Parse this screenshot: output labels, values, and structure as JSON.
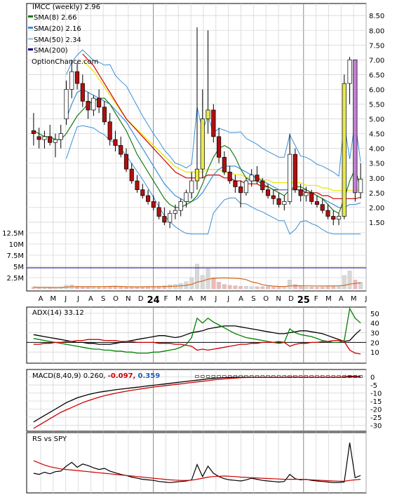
{
  "chart_data": [
    {
      "type": "candlestick",
      "panel": "price",
      "title": "IMCC (weekly) 2.96",
      "watermark": "OptionChance.com",
      "legend": [
        {
          "label": "SMA(8) 2.66",
          "color": "#1a7a1a"
        },
        {
          "label": "SMA(20) 2.16",
          "color": "#3a8fd6"
        },
        {
          "label": "SMA(50) 2.34",
          "color": "#a8d0f0"
        },
        {
          "label": "SMA(200)",
          "color": "#00008b"
        }
      ],
      "y_ticks": [
        "8.50",
        "8.00",
        "7.50",
        "7.00",
        "6.50",
        "6.00",
        "5.50",
        "5.00",
        "4.50",
        "4.00",
        "3.50",
        "3.00",
        "2.50",
        "2.00",
        "1.50"
      ],
      "ylim": [
        1.0,
        8.6
      ],
      "volume_ticks": [
        "12.5M",
        "10M",
        "7.5M",
        "5M",
        "2.5M"
      ],
      "x_labels": [
        "A",
        "M",
        "J",
        "J",
        "A",
        "S",
        "O",
        "N",
        "D",
        "24",
        "F",
        "M",
        "A",
        "M",
        "J",
        "J",
        "A",
        "S",
        "O",
        "N",
        "D",
        "25",
        "F",
        "M",
        "A",
        "M",
        "J"
      ],
      "year_labels": [
        "24",
        "25"
      ],
      "candles": [
        {
          "o": 4.6,
          "h": 5.2,
          "l": 4.1,
          "c": 4.5
        },
        {
          "o": 4.4,
          "h": 4.7,
          "l": 4.0,
          "c": 4.3
        },
        {
          "o": 4.3,
          "h": 4.6,
          "l": 4.0,
          "c": 4.4
        },
        {
          "o": 4.4,
          "h": 4.8,
          "l": 4.1,
          "c": 4.2
        },
        {
          "o": 4.2,
          "h": 4.5,
          "l": 3.7,
          "c": 4.3
        },
        {
          "o": 4.3,
          "h": 4.8,
          "l": 4.0,
          "c": 4.5
        },
        {
          "o": 5.0,
          "h": 6.3,
          "l": 4.8,
          "c": 6.0
        },
        {
          "o": 6.0,
          "h": 7.0,
          "l": 5.7,
          "c": 6.6
        },
        {
          "o": 6.6,
          "h": 6.9,
          "l": 6.0,
          "c": 6.2
        },
        {
          "o": 6.2,
          "h": 6.5,
          "l": 5.4,
          "c": 5.6
        },
        {
          "o": 5.6,
          "h": 5.9,
          "l": 5.0,
          "c": 5.3
        },
        {
          "o": 5.3,
          "h": 5.8,
          "l": 5.1,
          "c": 5.7
        },
        {
          "o": 5.7,
          "h": 6.0,
          "l": 5.2,
          "c": 5.4
        },
        {
          "o": 5.4,
          "h": 5.6,
          "l": 4.8,
          "c": 4.9
        },
        {
          "o": 4.9,
          "h": 5.2,
          "l": 4.1,
          "c": 4.3
        },
        {
          "o": 4.3,
          "h": 4.6,
          "l": 3.9,
          "c": 4.1
        },
        {
          "o": 4.1,
          "h": 4.4,
          "l": 3.7,
          "c": 3.8
        },
        {
          "o": 3.8,
          "h": 4.0,
          "l": 3.2,
          "c": 3.3
        },
        {
          "o": 3.3,
          "h": 3.5,
          "l": 2.8,
          "c": 2.9
        },
        {
          "o": 2.9,
          "h": 3.1,
          "l": 2.5,
          "c": 2.6
        },
        {
          "o": 2.6,
          "h": 2.8,
          "l": 2.3,
          "c": 2.4
        },
        {
          "o": 2.4,
          "h": 2.6,
          "l": 2.1,
          "c": 2.2
        },
        {
          "o": 2.2,
          "h": 2.4,
          "l": 1.9,
          "c": 2.0
        },
        {
          "o": 2.0,
          "h": 2.2,
          "l": 1.6,
          "c": 1.7
        },
        {
          "o": 1.7,
          "h": 2.0,
          "l": 1.4,
          "c": 1.5
        },
        {
          "o": 1.5,
          "h": 1.9,
          "l": 1.3,
          "c": 1.8
        },
        {
          "o": 1.8,
          "h": 2.1,
          "l": 1.6,
          "c": 1.9
        },
        {
          "o": 1.9,
          "h": 2.3,
          "l": 1.7,
          "c": 2.2
        },
        {
          "o": 2.2,
          "h": 2.6,
          "l": 2.0,
          "c": 2.5
        },
        {
          "o": 2.5,
          "h": 3.2,
          "l": 2.3,
          "c": 2.9
        },
        {
          "o": 2.9,
          "h": 8.1,
          "l": 2.6,
          "c": 3.3
        },
        {
          "o": 3.3,
          "h": 6.0,
          "l": 3.0,
          "c": 5.0
        },
        {
          "o": 5.0,
          "h": 8.0,
          "l": 4.5,
          "c": 5.3
        },
        {
          "o": 5.3,
          "h": 5.5,
          "l": 4.2,
          "c": 4.4
        },
        {
          "o": 4.4,
          "h": 4.7,
          "l": 3.5,
          "c": 3.7
        },
        {
          "o": 3.7,
          "h": 3.9,
          "l": 3.1,
          "c": 3.2
        },
        {
          "o": 3.2,
          "h": 3.4,
          "l": 2.8,
          "c": 2.9
        },
        {
          "o": 2.9,
          "h": 3.1,
          "l": 2.5,
          "c": 2.7
        },
        {
          "o": 2.7,
          "h": 2.9,
          "l": 2.0,
          "c": 2.5
        },
        {
          "o": 2.5,
          "h": 3.0,
          "l": 2.4,
          "c": 2.9
        },
        {
          "o": 2.9,
          "h": 3.3,
          "l": 2.7,
          "c": 3.1
        },
        {
          "o": 3.1,
          "h": 3.4,
          "l": 2.8,
          "c": 2.9
        },
        {
          "o": 2.9,
          "h": 3.0,
          "l": 2.5,
          "c": 2.6
        },
        {
          "o": 2.6,
          "h": 2.8,
          "l": 2.3,
          "c": 2.4
        },
        {
          "o": 2.4,
          "h": 2.6,
          "l": 2.1,
          "c": 2.3
        },
        {
          "o": 2.3,
          "h": 2.5,
          "l": 2.0,
          "c": 2.1
        },
        {
          "o": 2.1,
          "h": 2.4,
          "l": 1.9,
          "c": 2.2
        },
        {
          "o": 2.2,
          "h": 4.5,
          "l": 2.1,
          "c": 3.8
        },
        {
          "o": 3.8,
          "h": 4.0,
          "l": 2.5,
          "c": 2.6
        },
        {
          "o": 2.6,
          "h": 2.8,
          "l": 2.2,
          "c": 2.4
        },
        {
          "o": 2.4,
          "h": 2.7,
          "l": 2.2,
          "c": 2.5
        },
        {
          "o": 2.5,
          "h": 2.6,
          "l": 2.1,
          "c": 2.2
        },
        {
          "o": 2.2,
          "h": 2.4,
          "l": 2.0,
          "c": 2.1
        },
        {
          "o": 2.1,
          "h": 2.3,
          "l": 1.8,
          "c": 1.9
        },
        {
          "o": 1.9,
          "h": 2.1,
          "l": 1.6,
          "c": 1.7
        },
        {
          "o": 1.7,
          "h": 1.9,
          "l": 1.4,
          "c": 1.6
        },
        {
          "o": 1.6,
          "h": 1.8,
          "l": 1.4,
          "c": 1.7
        },
        {
          "o": 1.7,
          "h": 6.5,
          "l": 1.6,
          "c": 6.2
        },
        {
          "o": 6.2,
          "h": 7.1,
          "l": 5.5,
          "c": 7.0
        },
        {
          "o": 7.0,
          "h": 7.0,
          "l": 2.2,
          "c": 2.5
        },
        {
          "o": 2.5,
          "h": 3.5,
          "l": 2.3,
          "c": 2.96
        }
      ],
      "sma8": [
        4.6,
        4.5,
        4.4,
        4.4,
        4.3,
        4.3,
        4.5,
        4.8,
        5.1,
        5.3,
        5.5,
        5.6,
        5.7,
        5.7,
        5.5,
        5.2,
        4.9,
        4.6,
        4.2,
        3.8,
        3.5,
        3.2,
        2.9,
        2.6,
        2.3,
        2.1,
        2.0,
        2.0,
        2.1,
        2.2,
        2.4,
        2.8,
        3.3,
        3.7,
        4.0,
        4.1,
        4.0,
        3.7,
        3.3,
        3.0,
        2.9,
        2.9,
        2.8,
        2.7,
        2.6,
        2.5,
        2.4,
        2.6,
        2.7,
        2.7,
        2.6,
        2.5,
        2.4,
        2.3,
        2.1,
        1.9,
        1.8,
        2.3,
        2.9,
        3.3,
        2.66
      ],
      "sma20": [
        null,
        null,
        null,
        null,
        null,
        null,
        5.0,
        5.5,
        5.9,
        6.0,
        5.9,
        5.8,
        5.7,
        5.6,
        5.5,
        5.3,
        5.1,
        4.9,
        4.6,
        4.3,
        4.0,
        3.7,
        3.4,
        3.1,
        2.8,
        2.6,
        2.4,
        2.3,
        2.2,
        2.2,
        2.3,
        2.5,
        2.8,
        3.1,
        3.3,
        3.4,
        3.4,
        3.4,
        3.3,
        3.2,
        3.1,
        3.0,
        2.9,
        2.8,
        2.7,
        2.6,
        2.6,
        2.6,
        2.6,
        2.6,
        2.6,
        2.5,
        2.4,
        2.3,
        2.2,
        2.1,
        2.0,
        2.0,
        2.1,
        2.1,
        2.16
      ],
      "sma50": [
        null,
        null,
        null,
        null,
        null,
        null,
        null,
        null,
        null,
        7.2,
        7.0,
        6.8,
        6.5,
        6.2,
        5.9,
        5.6,
        5.3,
        5.0,
        4.8,
        4.6,
        4.4,
        4.2,
        4.0,
        3.8,
        3.6,
        3.4,
        3.2,
        3.1,
        3.0,
        3.0,
        3.0,
        3.0,
        3.1,
        3.1,
        3.1,
        3.0,
        3.0,
        2.9,
        2.9,
        2.8,
        2.8,
        2.8,
        2.7,
        2.7,
        2.6,
        2.6,
        2.6,
        2.6,
        2.6,
        2.6,
        2.5,
        2.5,
        2.5,
        2.4,
        2.4,
        2.3,
        2.3,
        2.3,
        2.3,
        2.3,
        2.34
      ],
      "volume": [
        0.4,
        0.3,
        0.3,
        0.3,
        0.3,
        0.4,
        0.8,
        0.9,
        0.6,
        0.5,
        0.4,
        0.4,
        0.4,
        0.5,
        0.5,
        0.6,
        0.5,
        0.5,
        0.4,
        0.4,
        0.5,
        0.5,
        0.5,
        0.6,
        0.7,
        0.9,
        1.0,
        1.2,
        1.6,
        2.5,
        5.5,
        3.0,
        4.5,
        2.5,
        1.5,
        1.0,
        0.8,
        0.7,
        0.6,
        0.6,
        0.5,
        0.5,
        0.5,
        0.5,
        0.4,
        0.4,
        0.5,
        2.0,
        1.0,
        0.5,
        0.4,
        0.4,
        0.4,
        0.4,
        0.5,
        0.6,
        0.5,
        3.0,
        4.0,
        2.0,
        1.5
      ]
    },
    {
      "type": "line",
      "panel": "adx",
      "title": "ADX(14) 33.12",
      "y_ticks": [
        "50",
        "40",
        "30",
        "20",
        "10"
      ],
      "ylim": [
        0,
        55
      ],
      "series": [
        {
          "color": "#000000",
          "values": [
            28,
            27,
            26,
            25,
            24,
            23,
            22,
            21,
            20,
            20,
            19,
            19,
            18,
            18,
            18,
            19,
            20,
            21,
            22,
            23,
            24,
            25,
            26,
            27,
            27,
            26,
            25,
            26,
            28,
            30,
            31,
            32,
            34,
            35,
            36,
            37,
            37,
            37,
            36,
            35,
            34,
            33,
            32,
            31,
            30,
            29,
            29,
            30,
            31,
            32,
            32,
            31,
            30,
            29,
            27,
            25,
            23,
            21,
            22,
            28,
            33.12
          ]
        },
        {
          "color": "#008000",
          "values": [
            24,
            23,
            22,
            21,
            20,
            19,
            18,
            17,
            16,
            15,
            14,
            13,
            13,
            12,
            12,
            11,
            11,
            10,
            10,
            9,
            9,
            9,
            10,
            10,
            11,
            12,
            13,
            15,
            18,
            25,
            45,
            40,
            45,
            41,
            38,
            35,
            32,
            29,
            27,
            25,
            24,
            23,
            22,
            21,
            20,
            19,
            20,
            34,
            30,
            28,
            27,
            26,
            24,
            22,
            21,
            20,
            20,
            22,
            55,
            45,
            40
          ]
        },
        {
          "color": "#cc0000",
          "values": [
            18,
            18,
            19,
            19,
            20,
            20,
            21,
            21,
            22,
            22,
            23,
            23,
            23,
            22,
            22,
            22,
            21,
            21,
            21,
            20,
            20,
            20,
            20,
            19,
            19,
            19,
            18,
            18,
            17,
            16,
            12,
            13,
            12,
            13,
            14,
            15,
            16,
            17,
            18,
            18,
            19,
            19,
            20,
            20,
            20,
            21,
            20,
            16,
            18,
            19,
            19,
            20,
            20,
            21,
            21,
            22,
            22,
            21,
            12,
            9,
            8
          ]
        }
      ]
    },
    {
      "type": "line",
      "panel": "macd",
      "title": "MACD(8,40,9) 0.260,",
      "values_text": [
        "-0.097,",
        "0.359"
      ],
      "value_colors": [
        "#cc0000",
        "#1f5fbf"
      ],
      "y_ticks": [
        "0",
        "-5",
        "-10",
        "-15",
        "-20",
        "-25",
        "-30"
      ],
      "ylim": [
        -32,
        2
      ],
      "series": [
        {
          "color": "#000000",
          "values": [
            -28,
            -26,
            -24,
            -22,
            -20,
            -18,
            -16,
            -14.5,
            -13,
            -12,
            -11,
            -10.2,
            -9.5,
            -9,
            -8.5,
            -8,
            -7.6,
            -7.2,
            -6.8,
            -6.4,
            -6,
            -5.6,
            -5.2,
            -4.8,
            -4.4,
            -4,
            -3.6,
            -3.2,
            -2.8,
            -2.4,
            -2,
            -1.6,
            -1.2,
            -0.9,
            -0.6,
            -0.4,
            -0.3,
            -0.2,
            -0.2,
            -0.2,
            -0.2,
            -0.2,
            -0.2,
            -0.2,
            -0.2,
            -0.2,
            -0.2,
            0,
            -0.1,
            -0.2,
            -0.2,
            -0.2,
            -0.2,
            -0.2,
            -0.2,
            -0.2,
            -0.2,
            0.1,
            0.4,
            0.3,
            0.26
          ]
        },
        {
          "color": "#cc0000",
          "values": [
            -32,
            -30,
            -28,
            -26,
            -24,
            -22,
            -20.5,
            -19,
            -17.5,
            -16,
            -14.8,
            -13.7,
            -12.6,
            -11.7,
            -10.9,
            -10.2,
            -9.5,
            -8.9,
            -8.3,
            -7.8,
            -7.3,
            -6.8,
            -6.3,
            -5.9,
            -5.5,
            -5.1,
            -4.7,
            -4.3,
            -3.9,
            -3.5,
            -3.1,
            -2.7,
            -2.3,
            -1.9,
            -1.5,
            -1.2,
            -0.9,
            -0.7,
            -0.5,
            -0.4,
            -0.3,
            -0.3,
            -0.3,
            -0.3,
            -0.3,
            -0.3,
            -0.3,
            -0.2,
            -0.2,
            -0.2,
            -0.2,
            -0.2,
            -0.2,
            -0.2,
            -0.2,
            -0.2,
            -0.2,
            -0.1,
            0.0,
            -0.05,
            -0.097
          ]
        }
      ]
    },
    {
      "type": "line",
      "panel": "rs",
      "title": "RS vs SPY",
      "ylim": [
        0,
        10
      ],
      "series": [
        {
          "color": "#000000",
          "values": [
            3.2,
            3.0,
            3.4,
            3.1,
            3.5,
            3.6,
            4.5,
            5.2,
            4.3,
            4.9,
            4.6,
            4.2,
            3.9,
            4.1,
            3.6,
            3.3,
            3.0,
            2.8,
            2.5,
            2.3,
            2.1,
            2.0,
            1.9,
            1.7,
            1.6,
            1.5,
            1.6,
            1.7,
            1.8,
            2.0,
            4.8,
            2.6,
            4.5,
            3.2,
            2.6,
            2.2,
            2.0,
            1.9,
            1.8,
            2.0,
            2.3,
            2.1,
            1.9,
            1.8,
            1.7,
            1.6,
            1.7,
            3.0,
            2.2,
            2.0,
            2.1,
            1.9,
            1.8,
            1.7,
            1.6,
            1.5,
            1.5,
            1.6,
            8.8,
            2.4,
            2.8
          ]
        },
        {
          "color": "#cc0000",
          "values": [
            5.5,
            5.1,
            4.7,
            4.4,
            4.2,
            4.0,
            3.9,
            3.8,
            3.7,
            3.6,
            3.5,
            3.4,
            3.3,
            3.2,
            3.1,
            3.0,
            2.9,
            2.8,
            2.7,
            2.6,
            2.5,
            2.4,
            2.3,
            2.2,
            2.1,
            2.0,
            1.95,
            1.9,
            1.9,
            1.95,
            2.1,
            2.3,
            2.5,
            2.6,
            2.65,
            2.7,
            2.65,
            2.6,
            2.5,
            2.45,
            2.4,
            2.35,
            2.3,
            2.25,
            2.2,
            2.15,
            2.1,
            2.1,
            2.1,
            2.1,
            2.05,
            2.0,
            1.95,
            1.9,
            1.85,
            1.8,
            1.75,
            1.75,
            1.9,
            2.0,
            2.1
          ]
        }
      ]
    }
  ]
}
